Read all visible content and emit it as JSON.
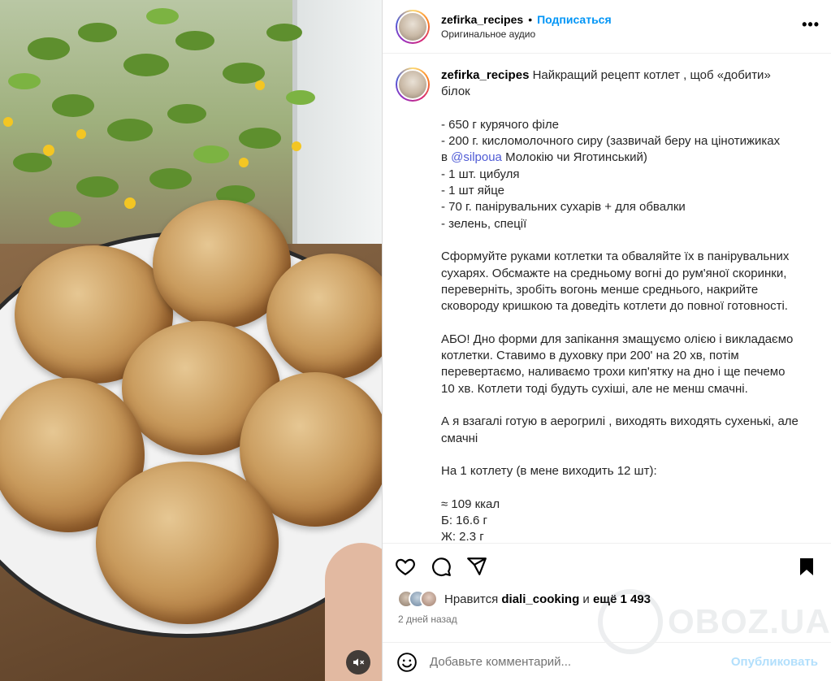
{
  "post": {
    "username": "zefirka_recipes",
    "separator": "•",
    "follow_label": "Подписаться",
    "audio_label": "Оригинальное аудио",
    "more_label": "•••"
  },
  "caption": {
    "username": "zefirka_recipes",
    "lines": [
      {
        "text": "Найкращий рецепт котлет , щоб «добити»"
      },
      {
        "text": "білок"
      },
      {
        "text": ""
      },
      {
        "text": "- 650 г курячого філе"
      },
      {
        "text": "- 200 г. кисломолочного сиру (зазвичай беру на цінотижиках"
      },
      {
        "pre": "в ",
        "mention": "@silpoua",
        "post": " Молокію чи Яготинський)"
      },
      {
        "text": "- 1 шт. цибуля"
      },
      {
        "text": "- 1 шт яйце"
      },
      {
        "text": "- 70 г. панірувальних сухарів + для обвалки"
      },
      {
        "text": "- зелень, спеції"
      },
      {
        "text": ""
      },
      {
        "text": "Сформуйте руками котлетки та обваляйте їх в панірувальних"
      },
      {
        "text": "сухарях. Обсмажте на средньому вогні до рум'яної скоринки,"
      },
      {
        "text": "переверніть, зробіть вогонь менше среднього, накрийте"
      },
      {
        "text": "сковороду кришкою та доведіть котлети до повної готовності."
      },
      {
        "text": ""
      },
      {
        "text": "АБО! Дно форми для запікання змащуємо олією і викладаємо"
      },
      {
        "text": "котлетки. Ставимо в духовку при 200' на 20 хв, потім"
      },
      {
        "text": "перевертаємо, наливаємо трохи кип'ятку на дно і ще печемо"
      },
      {
        "text": "10 хв. Котлети тоді будуть сухіші, але не менш смачні."
      },
      {
        "text": ""
      },
      {
        "text": "А я взагалі готую в аерогрилі , виходять виходять сухенькі, але"
      },
      {
        "text": "смачні"
      },
      {
        "text": ""
      },
      {
        "text": "На 1 котлету (в мене виходить 12 шт):"
      },
      {
        "text": ""
      },
      {
        "text": "≈ 109 ккал"
      },
      {
        "text": "Б: 16.6 г"
      },
      {
        "text": "Ж: 2.3 г"
      }
    ]
  },
  "likes": {
    "prefix": "Нравится",
    "user": "diali_cooking",
    "middle": "и",
    "more": "ещё 1 493"
  },
  "date_label": "2 дней назад",
  "comment": {
    "placeholder": "Добавьте комментарий...",
    "publish_label": "Опубликовать"
  },
  "watermark": "OBOZ.UA",
  "colors": {
    "link": "#0095f6",
    "publish_disabled": "#b2dffc",
    "muted_text": "#737373"
  }
}
